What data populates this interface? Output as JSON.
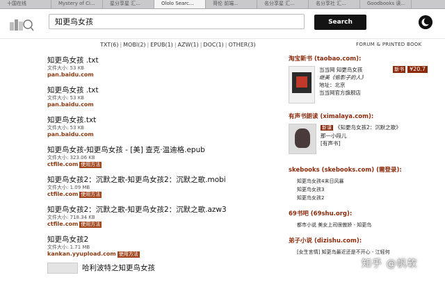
{
  "browser": {
    "tabs": [
      {
        "label": "十国在线"
      },
      {
        "label": "Mystery of Ci..."
      },
      {
        "label": "星分享星 汇..."
      },
      {
        "label": "Ololo Searc...",
        "active": true
      },
      {
        "label": "哥伦 前端..."
      },
      {
        "label": "名分享星 汇..."
      },
      {
        "label": "名分享社 汇..."
      },
      {
        "label": "Goodbooks 读..."
      }
    ]
  },
  "header": {
    "search_value": "知更鸟女孩",
    "search_button": "Search"
  },
  "format_bar": {
    "items": [
      "TXT(6)",
      "MOBI(2)",
      "EPUB(1)",
      "AZW(1)",
      "DOC(1)",
      "OTHER(3)"
    ],
    "separator": "|"
  },
  "forum_link": "FORUM & PRINTED BOOK",
  "results": [
    {
      "title": "知更鸟女孩 .txt",
      "size": "文件大小: 53 KB",
      "source": "pan.baidu.com",
      "method": ""
    },
    {
      "title": "知更鸟女孩 .txt",
      "size": "文件大小: 53 KB",
      "source": "pan.baidu.com",
      "method": ""
    },
    {
      "title": "知更鸟女孩.txt",
      "size": "文件大小: 53 KB",
      "source": "pan.baidu.com",
      "method": ""
    },
    {
      "title": "知更鸟女孩-知更鸟女孩 - [美] 查克·温迪格.epub",
      "size": "文件大小: 323.06 KB",
      "source": "ctfile.com",
      "method": "使用方法"
    },
    {
      "title": "知更鸟女孩2：沉默之歌-知更鸟女孩2：沉默之歌.mobi",
      "size": "文件大小: 1.09 MB",
      "source": "ctfile.com",
      "method": "使用方法"
    },
    {
      "title": "知更鸟女孩2：沉默之歌-知更鸟女孩2：沉默之歌.azw3",
      "size": "文件大小: 718.34 KB",
      "source": "ctfile.com",
      "method": "使用方法"
    },
    {
      "title": "知更鸟女孩2",
      "size": "文件大小: 1.71 MB",
      "source": "kankan.yyupload.com",
      "method": "使用方法"
    }
  ],
  "partial_result": {
    "title": "哈利波特之知更鸟女孩"
  },
  "sidebar": {
    "taobao": {
      "title": "淘宝新书 (taobao.com):",
      "line1": "当当网 知更鸟女孩",
      "line2": "继美《偷影子的人》",
      "line3": "地址：北京",
      "line4": "当当网官方旗舰店",
      "tag": "新书",
      "price": "¥20.7"
    },
    "ximalaya": {
      "title": "有声书朗读 (ximalaya.com):",
      "new_tag": "新课",
      "line1": "《知更鸟女孩2：沉默之歌》",
      "line2": "那一小段儿",
      "line3": "[有声书]"
    },
    "skebooks": {
      "title": "skebooks (skebooks.com) (需登录):",
      "items": [
        "知更鸟女孩4末日风暴",
        "知更鸟女孩3",
        "知更鸟女孩2"
      ]
    },
    "shu69": {
      "title": "69书吧 (69shu.org):",
      "items": [
        "都市小说 美女上司很傲娇 - 知更鸟"
      ]
    },
    "dizishu": {
      "title": "弟子小说 (dizishu.com):",
      "items": [
        "[女生言情] 知更鸟最近还是不开心 - 江轻何"
      ]
    }
  },
  "watermark": "知乎 @帆软",
  "colors": {
    "accent": "#8b2a0b",
    "button_dark": "#141414"
  }
}
